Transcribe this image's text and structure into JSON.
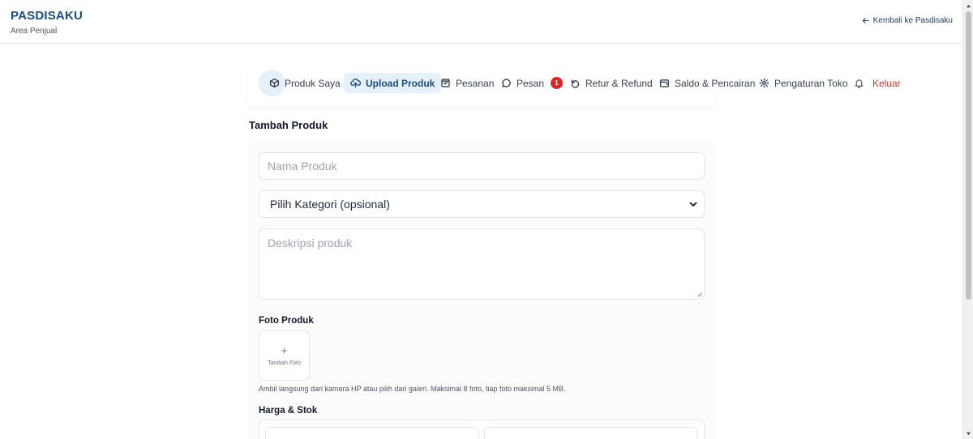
{
  "header": {
    "brand": "PASDISAKU",
    "subtitle": "Area Penjual",
    "back_link": "Kembali ke Pasdisaku"
  },
  "nav": {
    "items": [
      {
        "label": "Produk Saya",
        "icon": "box-icon",
        "active": false
      },
      {
        "label": "Upload Produk",
        "icon": "cloud-upload-icon",
        "active": true
      },
      {
        "label": "Pesanan",
        "icon": "clipboard-icon",
        "active": false
      },
      {
        "label": "Pesan",
        "icon": "chat-bubble-icon",
        "active": false,
        "badge": "1"
      },
      {
        "label": "Retur & Refund",
        "icon": "undo-icon",
        "active": false
      },
      {
        "label": "Saldo & Pencairan",
        "icon": "wallet-icon",
        "active": false
      },
      {
        "label": "Pengaturan Toko",
        "icon": "gear-icon",
        "active": false
      },
      {
        "label": "Keluar",
        "icon": "bell-icon",
        "active": false
      }
    ]
  },
  "page": {
    "title": "Tambah Produk"
  },
  "form": {
    "name_placeholder": "Nama Produk",
    "category_selected": "Pilih Kategori (opsional)",
    "description_placeholder": "Deskripsi produk",
    "photo_label": "Foto Produk",
    "add_photo_label": "Tambah Foto",
    "add_photo_icon": "+",
    "photo_hint": "Ambil langsung dari kamera HP atau pilih dari galeri. Maksimal 8 foto, tiap foto maksimal 5 MB.",
    "price_stock_label": "Harga & Stok"
  },
  "colors": {
    "brand": "#1a4d78",
    "active_bg": "#e5f0f8",
    "logout": "#c0392b",
    "badge": "#dc2626"
  }
}
